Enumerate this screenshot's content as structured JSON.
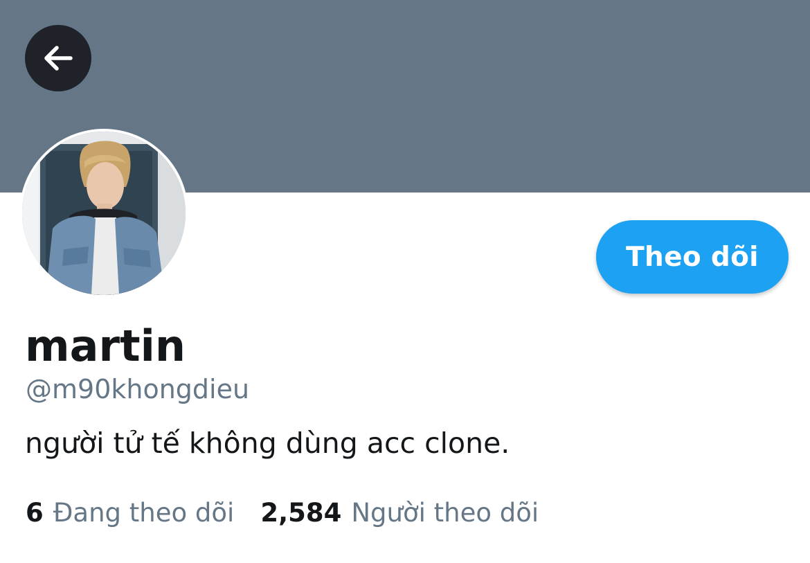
{
  "header": {
    "banner_color": "#657786",
    "back_icon": "arrow-left-icon"
  },
  "profile": {
    "avatar_description": "profile-photo",
    "display_name": "martin",
    "handle": "@m90khongdieu",
    "bio": "người tử tế không dùng acc clone.",
    "follow_label": "Theo dõi",
    "accent_color": "#1da1f2"
  },
  "stats": {
    "following_count": "6",
    "following_label": "Đang theo dõi",
    "followers_count": "2,584",
    "followers_label": "Người theo dõi"
  }
}
